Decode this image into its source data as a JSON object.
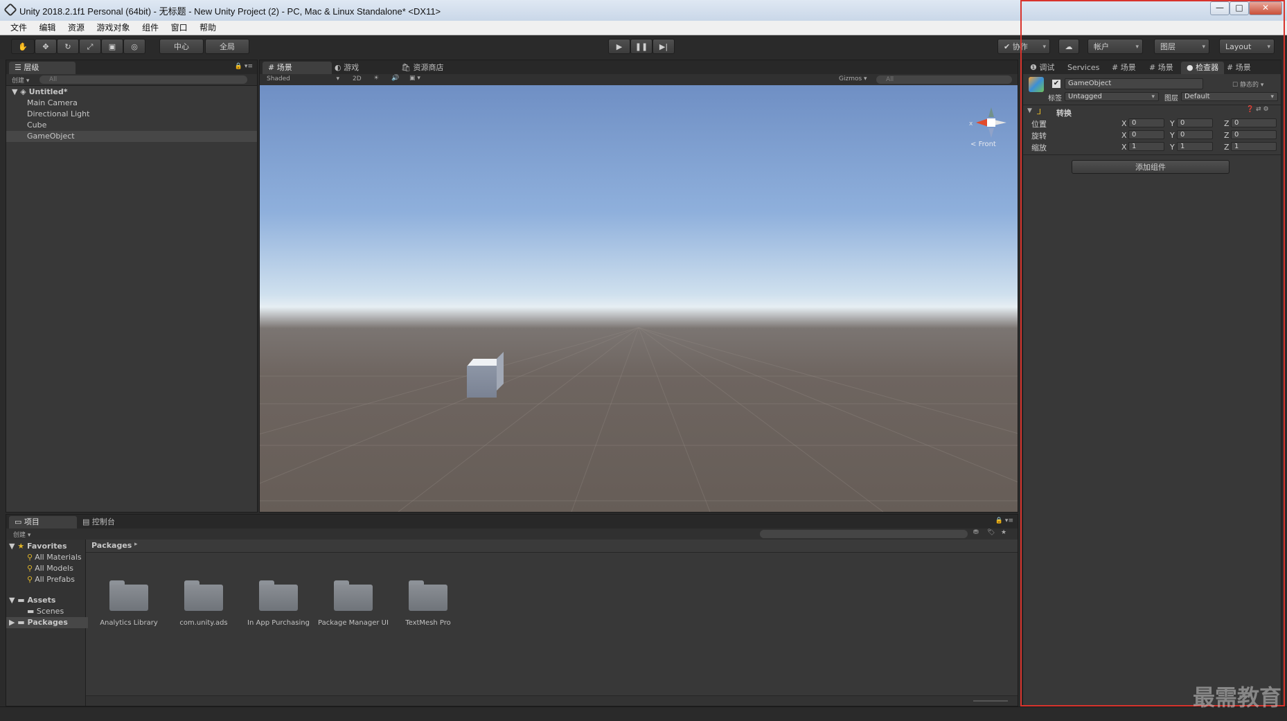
{
  "window": {
    "title": "Unity 2018.2.1f1 Personal (64bit) - 无标题 - New Unity Project (2) - PC, Mac & Linux Standalone* <DX11>",
    "minimize": "—",
    "maximize": "□",
    "close": "✕"
  },
  "menu": [
    "文件",
    "编辑",
    "资源",
    "游戏对象",
    "组件",
    "窗口",
    "帮助"
  ],
  "toolbar": {
    "pivot": "中心",
    "space": "全局",
    "collab": "协作",
    "account": "帐户",
    "layers": "图层",
    "layout": "Layout"
  },
  "hierarchy": {
    "tab": "层级",
    "create": "创建",
    "search_placeholder": "All",
    "scene": "Untitled*",
    "items": [
      "Main Camera",
      "Directional Light",
      "Cube",
      "GameObject"
    ]
  },
  "scene": {
    "tabs": [
      "场景",
      "游戏",
      "资源商店"
    ],
    "shading": "Shaded",
    "mode_2d": "2D",
    "gizmos": "Gizmos",
    "search_placeholder": "All",
    "gizmo_label": "Front",
    "axis_x": "x"
  },
  "inspector": {
    "tabs": [
      "调试",
      "Services",
      "场景",
      "场景",
      "检查器",
      "场景"
    ],
    "object_name": "GameObject",
    "static_label": "静态的",
    "tag_label": "标签",
    "tag_value": "Untagged",
    "layer_label": "图层",
    "layer_value": "Default",
    "component": "转换",
    "rows": [
      {
        "label": "位置",
        "x": "0",
        "y": "0",
        "z": "0"
      },
      {
        "label": "旋转",
        "x": "0",
        "y": "0",
        "z": "0"
      },
      {
        "label": "缩放",
        "x": "1",
        "y": "1",
        "z": "1"
      }
    ],
    "axis": {
      "x": "X",
      "y": "Y",
      "z": "Z"
    },
    "add_component": "添加组件"
  },
  "project": {
    "tabs": [
      "项目",
      "控制台"
    ],
    "create": "创建",
    "favorites": "Favorites",
    "fav_items": [
      "All Materials",
      "All Models",
      "All Prefabs"
    ],
    "assets": "Assets",
    "scenes": "Scenes",
    "packages": "Packages",
    "breadcrumb": "Packages",
    "folders": [
      "Analytics Library",
      "com.unity.ads",
      "In App Purchasing",
      "Package Manager UI",
      "TextMesh Pro"
    ]
  },
  "watermark": "最需教育",
  "colors": {
    "highlight_frame": "#d8332c",
    "panel": "#383838"
  }
}
